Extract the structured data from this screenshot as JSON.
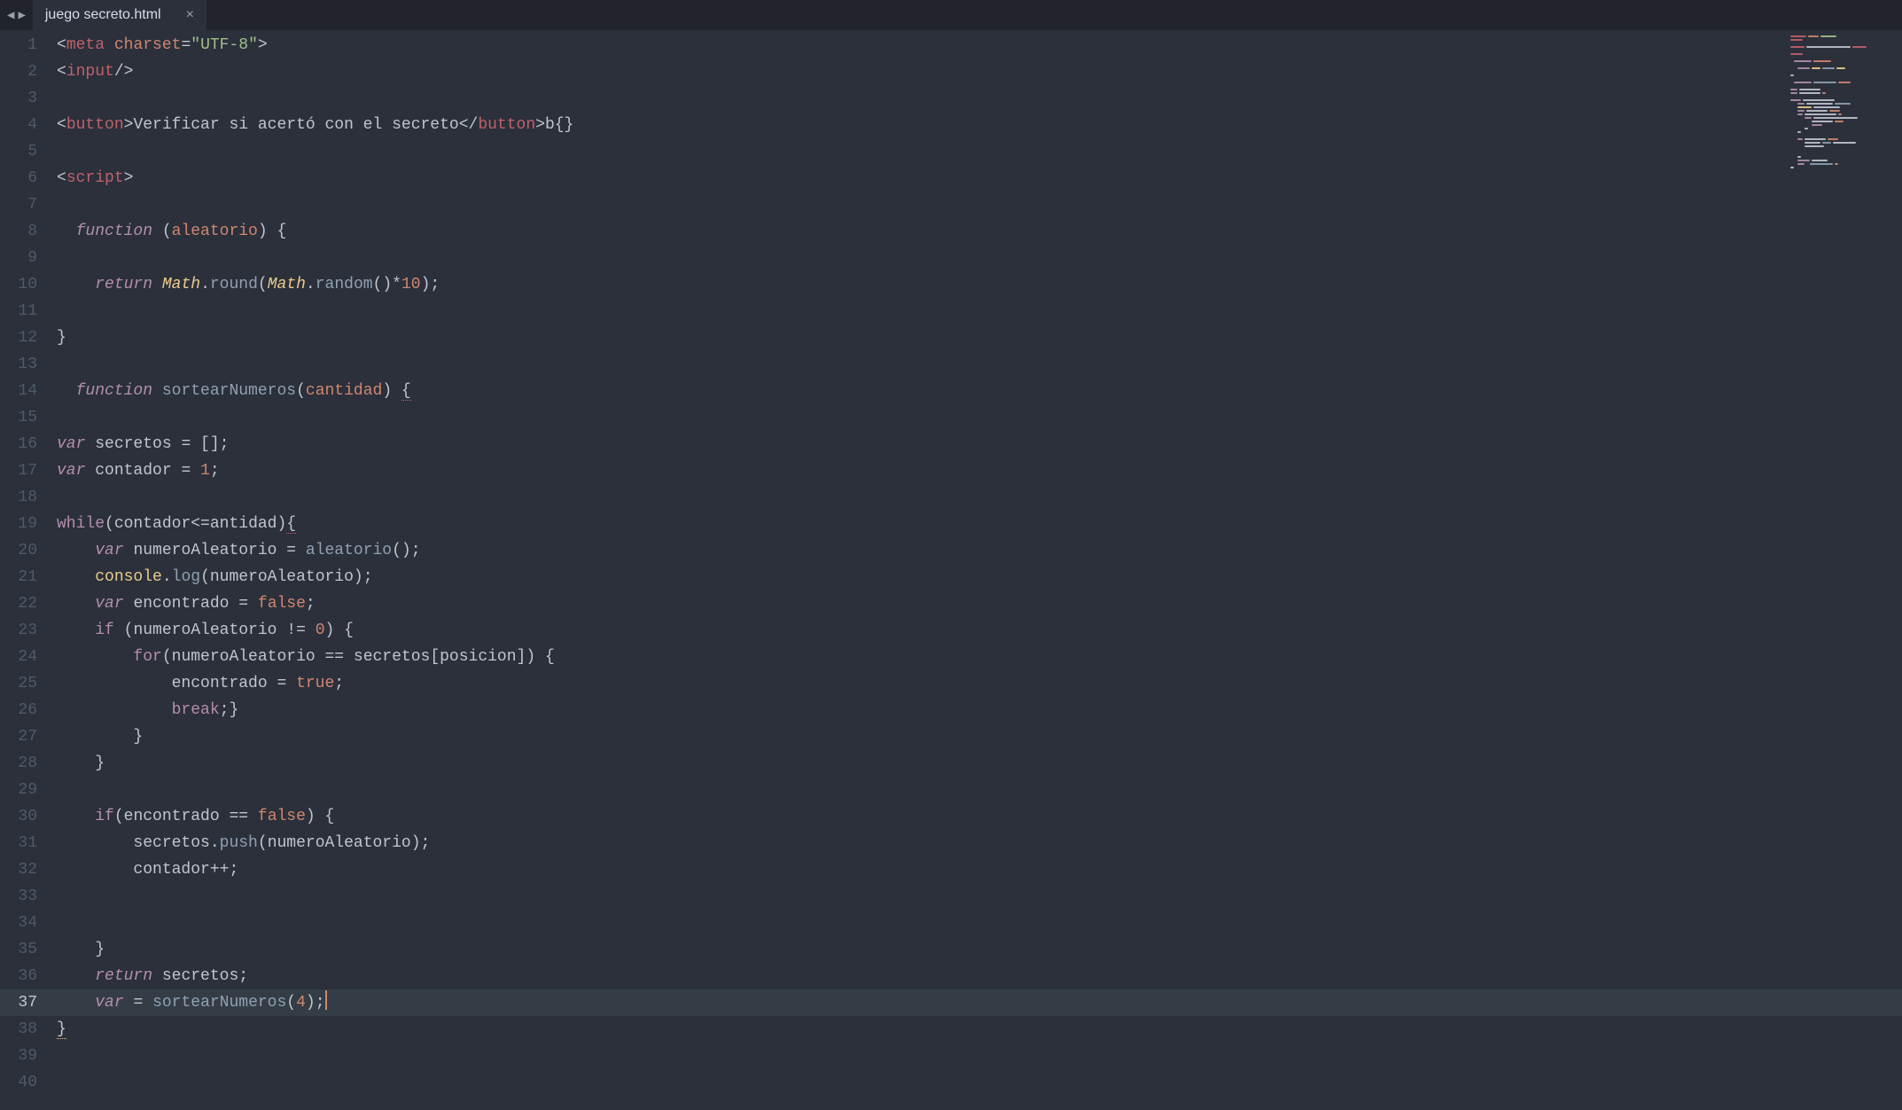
{
  "tab": {
    "title": "juego secreto.html",
    "close_glyph": "×"
  },
  "nav": {
    "prev": "◀",
    "next": "▶"
  },
  "gutter": {
    "line_count": 40,
    "active_line": 37
  },
  "code": {
    "lines": [
      {
        "n": 1,
        "seg": [
          [
            "p",
            "<"
          ],
          [
            "tag",
            "meta"
          ],
          [
            "p",
            " "
          ],
          [
            "attn",
            "charset"
          ],
          [
            "p",
            "="
          ],
          [
            "str",
            "\"UTF-8\""
          ],
          [
            "p",
            ">"
          ]
        ]
      },
      {
        "n": 2,
        "seg": [
          [
            "p",
            "<"
          ],
          [
            "tag",
            "input"
          ],
          [
            "p",
            "/>"
          ]
        ]
      },
      {
        "n": 3,
        "seg": []
      },
      {
        "n": 4,
        "seg": [
          [
            "p",
            "<"
          ],
          [
            "tag",
            "button"
          ],
          [
            "p",
            ">"
          ],
          [
            "txt",
            "Verificar si acertó con el secreto"
          ],
          [
            "p",
            "</"
          ],
          [
            "tag",
            "button"
          ],
          [
            "p",
            ">"
          ],
          [
            "txt",
            "b{}"
          ]
        ]
      },
      {
        "n": 5,
        "seg": []
      },
      {
        "n": 6,
        "seg": [
          [
            "p",
            "<"
          ],
          [
            "tag",
            "script"
          ],
          [
            "p",
            ">"
          ]
        ]
      },
      {
        "n": 7,
        "seg": []
      },
      {
        "n": 8,
        "seg": [
          [
            "p",
            "  "
          ],
          [
            "st",
            "function"
          ],
          [
            "p",
            " ("
          ],
          [
            "par",
            "aleatorio"
          ],
          [
            "p",
            ") {"
          ]
        ]
      },
      {
        "n": 9,
        "seg": []
      },
      {
        "n": 10,
        "seg": [
          [
            "p",
            "    "
          ],
          [
            "st",
            "return"
          ],
          [
            "p",
            " "
          ],
          [
            "cls",
            "Math"
          ],
          [
            "p",
            "."
          ],
          [
            "fn",
            "round"
          ],
          [
            "p",
            "("
          ],
          [
            "cls",
            "Math"
          ],
          [
            "p",
            "."
          ],
          [
            "fn",
            "random"
          ],
          [
            "p",
            "()"
          ],
          [
            "op",
            "*"
          ],
          [
            "num",
            "10"
          ],
          [
            "p",
            ");"
          ]
        ]
      },
      {
        "n": 11,
        "seg": []
      },
      {
        "n": 12,
        "seg": [
          [
            "p",
            "}"
          ]
        ]
      },
      {
        "n": 13,
        "seg": []
      },
      {
        "n": 14,
        "seg": [
          [
            "p",
            "  "
          ],
          [
            "st",
            "function"
          ],
          [
            "p",
            " "
          ],
          [
            "fn",
            "sortearNumeros"
          ],
          [
            "p",
            "("
          ],
          [
            "par",
            "cantidad"
          ],
          [
            "p",
            ") "
          ],
          [
            "pU",
            "{"
          ]
        ]
      },
      {
        "n": 15,
        "seg": []
      },
      {
        "n": 16,
        "seg": [
          [
            "st",
            "var"
          ],
          [
            "p",
            " "
          ],
          [
            "txt",
            "secretos "
          ],
          [
            "op",
            "="
          ],
          [
            "p",
            " [];"
          ]
        ]
      },
      {
        "n": 17,
        "seg": [
          [
            "st",
            "var"
          ],
          [
            "p",
            " "
          ],
          [
            "txt",
            "contador "
          ],
          [
            "op",
            "="
          ],
          [
            "p",
            " "
          ],
          [
            "num",
            "1"
          ],
          [
            "p",
            ";"
          ]
        ]
      },
      {
        "n": 18,
        "seg": []
      },
      {
        "n": 19,
        "seg": [
          [
            "kw",
            "while"
          ],
          [
            "p",
            "("
          ],
          [
            "txt",
            "contador"
          ],
          [
            "op",
            "<="
          ],
          [
            "txt",
            "antidad"
          ],
          [
            "p",
            ")"
          ],
          [
            "pU",
            "{"
          ]
        ]
      },
      {
        "n": 20,
        "seg": [
          [
            "p",
            "    "
          ],
          [
            "st",
            "var"
          ],
          [
            "p",
            " "
          ],
          [
            "txt",
            "numeroAleatorio "
          ],
          [
            "op",
            "="
          ],
          [
            "p",
            " "
          ],
          [
            "fn",
            "aleatorio"
          ],
          [
            "p",
            "();"
          ]
        ]
      },
      {
        "n": 21,
        "seg": [
          [
            "p",
            "    "
          ],
          [
            "obj",
            "console"
          ],
          [
            "p",
            "."
          ],
          [
            "fn",
            "log"
          ],
          [
            "p",
            "("
          ],
          [
            "txt",
            "numeroAleatorio"
          ],
          [
            "p",
            ");"
          ]
        ]
      },
      {
        "n": 22,
        "seg": [
          [
            "p",
            "    "
          ],
          [
            "st",
            "var"
          ],
          [
            "p",
            " "
          ],
          [
            "txt",
            "encontrado "
          ],
          [
            "op",
            "="
          ],
          [
            "p",
            " "
          ],
          [
            "cnst",
            "false"
          ],
          [
            "p",
            ";"
          ]
        ]
      },
      {
        "n": 23,
        "seg": [
          [
            "p",
            "    "
          ],
          [
            "kw",
            "if"
          ],
          [
            "p",
            " ("
          ],
          [
            "txt",
            "numeroAleatorio "
          ],
          [
            "op",
            "!="
          ],
          [
            "p",
            " "
          ],
          [
            "num",
            "0"
          ],
          [
            "p",
            ") {"
          ]
        ]
      },
      {
        "n": 24,
        "seg": [
          [
            "p",
            "        "
          ],
          [
            "kw",
            "for"
          ],
          [
            "p",
            "("
          ],
          [
            "txt",
            "numeroAleatorio "
          ],
          [
            "op",
            "=="
          ],
          [
            "p",
            " "
          ],
          [
            "txt",
            "secretos"
          ],
          [
            "p",
            "["
          ],
          [
            "txt",
            "posicion"
          ],
          [
            "p",
            "]) {"
          ]
        ]
      },
      {
        "n": 25,
        "seg": [
          [
            "p",
            "            "
          ],
          [
            "txt",
            "encontrado "
          ],
          [
            "op",
            "="
          ],
          [
            "p",
            " "
          ],
          [
            "cnst",
            "true"
          ],
          [
            "p",
            ";"
          ]
        ]
      },
      {
        "n": 26,
        "seg": [
          [
            "p",
            "            "
          ],
          [
            "kw",
            "break"
          ],
          [
            "p",
            ";}"
          ]
        ]
      },
      {
        "n": 27,
        "seg": [
          [
            "p",
            "        }"
          ]
        ]
      },
      {
        "n": 28,
        "seg": [
          [
            "p",
            "    }"
          ]
        ]
      },
      {
        "n": 29,
        "seg": []
      },
      {
        "n": 30,
        "seg": [
          [
            "p",
            "    "
          ],
          [
            "kw",
            "if"
          ],
          [
            "p",
            "("
          ],
          [
            "txt",
            "encontrado "
          ],
          [
            "op",
            "=="
          ],
          [
            "p",
            " "
          ],
          [
            "cnst",
            "false"
          ],
          [
            "p",
            ") {"
          ]
        ]
      },
      {
        "n": 31,
        "seg": [
          [
            "p",
            "        "
          ],
          [
            "txt",
            "secretos"
          ],
          [
            "p",
            "."
          ],
          [
            "fn",
            "push"
          ],
          [
            "p",
            "("
          ],
          [
            "txt",
            "numeroAleatorio"
          ],
          [
            "p",
            ");"
          ]
        ]
      },
      {
        "n": 32,
        "seg": [
          [
            "p",
            "        "
          ],
          [
            "txt",
            "contador"
          ],
          [
            "op",
            "++"
          ],
          [
            "p",
            ";"
          ]
        ]
      },
      {
        "n": 33,
        "seg": []
      },
      {
        "n": 34,
        "seg": []
      },
      {
        "n": 35,
        "seg": [
          [
            "p",
            "    }"
          ]
        ]
      },
      {
        "n": 36,
        "seg": [
          [
            "p",
            "    "
          ],
          [
            "st",
            "return"
          ],
          [
            "p",
            " "
          ],
          [
            "txt",
            "secretos"
          ],
          [
            "p",
            ";"
          ]
        ]
      },
      {
        "n": 37,
        "seg": [
          [
            "p",
            "    "
          ],
          [
            "st",
            "var"
          ],
          [
            "p",
            " "
          ],
          [
            "op",
            "="
          ],
          [
            "p",
            " "
          ],
          [
            "fn",
            "sortearNumeros"
          ],
          [
            "p",
            "("
          ],
          [
            "num",
            "4"
          ],
          [
            "p",
            ");"
          ]
        ],
        "cursor": true
      },
      {
        "n": 38,
        "seg": [
          [
            "pY",
            "}"
          ]
        ]
      },
      {
        "n": 39,
        "seg": []
      },
      {
        "n": 40,
        "seg": []
      }
    ]
  },
  "minimap": {
    "rows": [
      [
        [
          0,
          18,
          "#bf616a"
        ],
        [
          20,
          12,
          "#d08770"
        ],
        [
          34,
          18,
          "#a3be8c"
        ]
      ],
      [
        [
          0,
          14,
          "#bf616a"
        ]
      ],
      [],
      [
        [
          0,
          16,
          "#bf616a"
        ],
        [
          18,
          50,
          "#c0c5ce"
        ],
        [
          70,
          16,
          "#bf616a"
        ]
      ],
      [],
      [
        [
          0,
          14,
          "#bf616a"
        ]
      ],
      [],
      [
        [
          4,
          20,
          "#b48ead"
        ],
        [
          26,
          20,
          "#d08770"
        ]
      ],
      [],
      [
        [
          8,
          14,
          "#b48ead"
        ],
        [
          24,
          10,
          "#ebcb8b"
        ],
        [
          36,
          14,
          "#8fa1b3"
        ],
        [
          52,
          10,
          "#ebcb8b"
        ]
      ],
      [],
      [
        [
          0,
          4,
          "#c0c5ce"
        ]
      ],
      [],
      [
        [
          4,
          20,
          "#b48ead"
        ],
        [
          26,
          26,
          "#8fa1b3"
        ],
        [
          54,
          14,
          "#d08770"
        ]
      ],
      [],
      [
        [
          0,
          8,
          "#b48ead"
        ],
        [
          10,
          24,
          "#c0c5ce"
        ]
      ],
      [
        [
          0,
          8,
          "#b48ead"
        ],
        [
          10,
          24,
          "#c0c5ce"
        ],
        [
          36,
          4,
          "#d08770"
        ]
      ],
      [],
      [
        [
          0,
          12,
          "#b48ead"
        ],
        [
          14,
          36,
          "#c0c5ce"
        ]
      ],
      [
        [
          8,
          8,
          "#b48ead"
        ],
        [
          18,
          30,
          "#c0c5ce"
        ],
        [
          50,
          18,
          "#8fa1b3"
        ]
      ],
      [
        [
          8,
          16,
          "#ebcb8b"
        ],
        [
          26,
          30,
          "#c0c5ce"
        ]
      ],
      [
        [
          8,
          8,
          "#b48ead"
        ],
        [
          18,
          24,
          "#c0c5ce"
        ],
        [
          44,
          12,
          "#d08770"
        ]
      ],
      [
        [
          8,
          6,
          "#b48ead"
        ],
        [
          16,
          36,
          "#c0c5ce"
        ],
        [
          54,
          4,
          "#d08770"
        ]
      ],
      [
        [
          16,
          8,
          "#b48ead"
        ],
        [
          26,
          50,
          "#c0c5ce"
        ]
      ],
      [
        [
          24,
          24,
          "#c0c5ce"
        ],
        [
          50,
          10,
          "#d08770"
        ]
      ],
      [
        [
          24,
          12,
          "#b48ead"
        ]
      ],
      [
        [
          16,
          4,
          "#c0c5ce"
        ]
      ],
      [
        [
          8,
          4,
          "#c0c5ce"
        ]
      ],
      [],
      [
        [
          8,
          6,
          "#b48ead"
        ],
        [
          16,
          24,
          "#c0c5ce"
        ],
        [
          42,
          12,
          "#d08770"
        ]
      ],
      [
        [
          16,
          18,
          "#c0c5ce"
        ],
        [
          36,
          10,
          "#8fa1b3"
        ],
        [
          48,
          26,
          "#c0c5ce"
        ]
      ],
      [
        [
          16,
          22,
          "#c0c5ce"
        ]
      ],
      [],
      [],
      [
        [
          8,
          4,
          "#c0c5ce"
        ]
      ],
      [
        [
          8,
          14,
          "#b48ead"
        ],
        [
          24,
          18,
          "#c0c5ce"
        ]
      ],
      [
        [
          8,
          8,
          "#b48ead"
        ],
        [
          22,
          26,
          "#8fa1b3"
        ],
        [
          50,
          4,
          "#d08770"
        ]
      ],
      [
        [
          0,
          4,
          "#c0c5ce"
        ]
      ]
    ]
  }
}
